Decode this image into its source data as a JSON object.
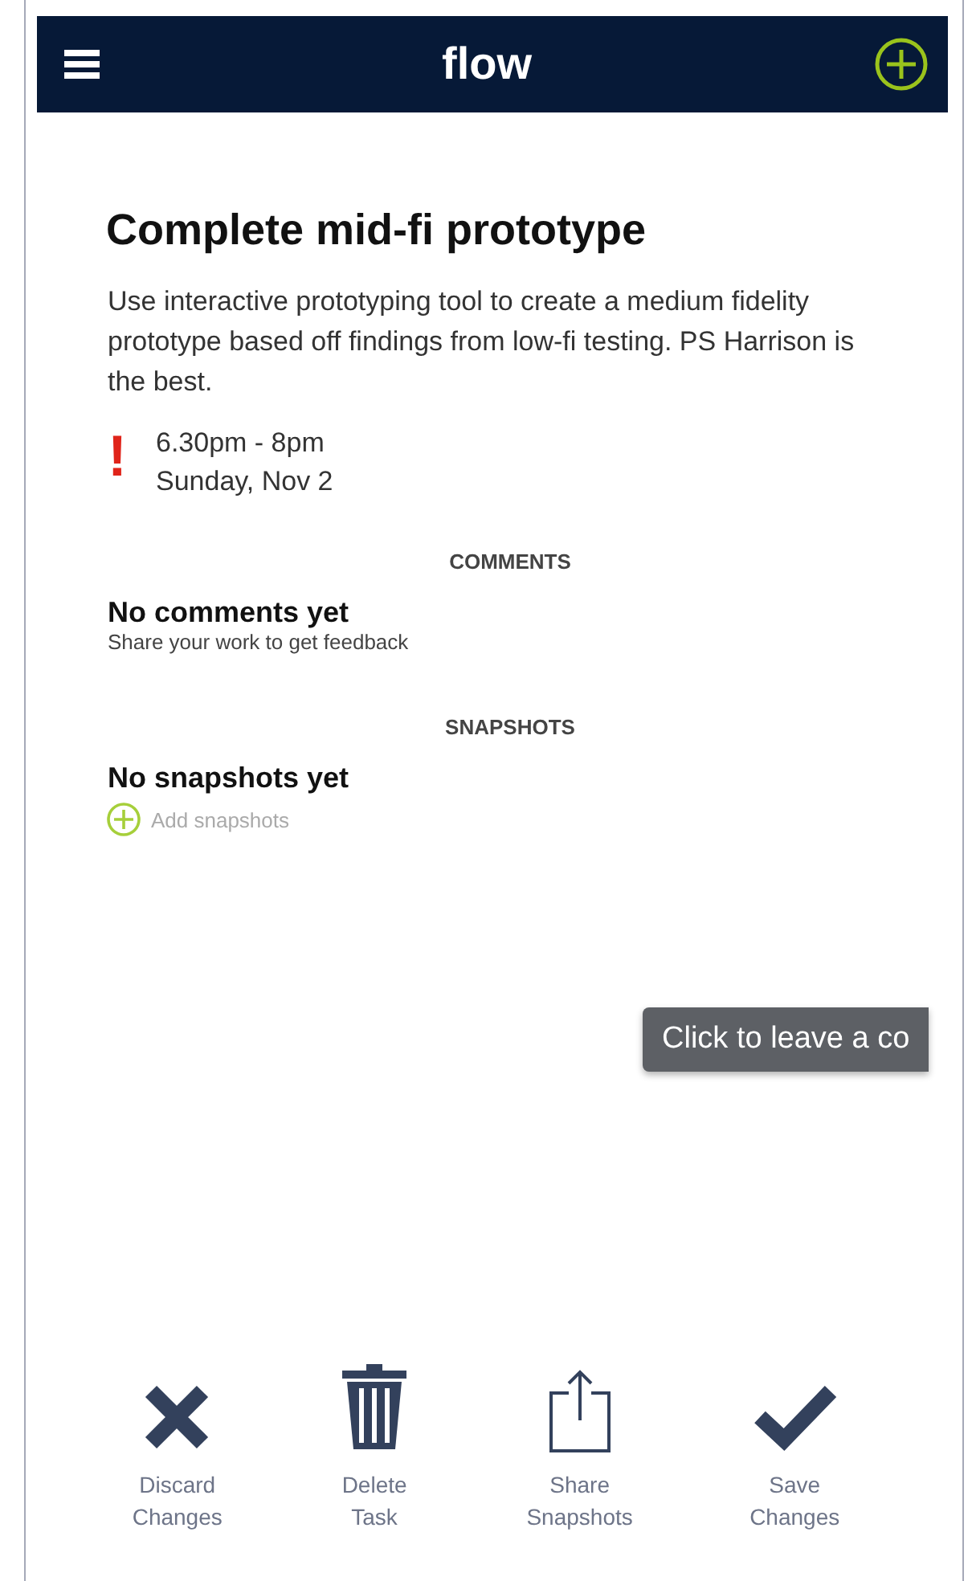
{
  "header": {
    "title": "flow"
  },
  "task": {
    "title": "Complete mid-fi prototype",
    "description": "Use interactive prototyping tool to create a medium fidelity prototype based off findings from low-fi testing. PS Harrison is the best.",
    "priority_mark": "!",
    "time": "6.30pm - 8pm",
    "date": "Sunday, Nov 2"
  },
  "comments": {
    "heading": "COMMENTS",
    "empty_title": "No comments yet",
    "empty_hint": "Share your work to get feedback"
  },
  "snapshots": {
    "heading": "SNAPSHOTS",
    "empty_title": "No snapshots yet",
    "add_label": "Add snapshots"
  },
  "tooltip": "Click to leave a co",
  "actions": [
    {
      "kind": "discard",
      "label": "Discard\nChanges"
    },
    {
      "kind": "delete",
      "label": "Delete\nTask"
    },
    {
      "kind": "share",
      "label": "Share\nSnapshots"
    },
    {
      "kind": "save",
      "label": "Save\nChanges"
    }
  ]
}
